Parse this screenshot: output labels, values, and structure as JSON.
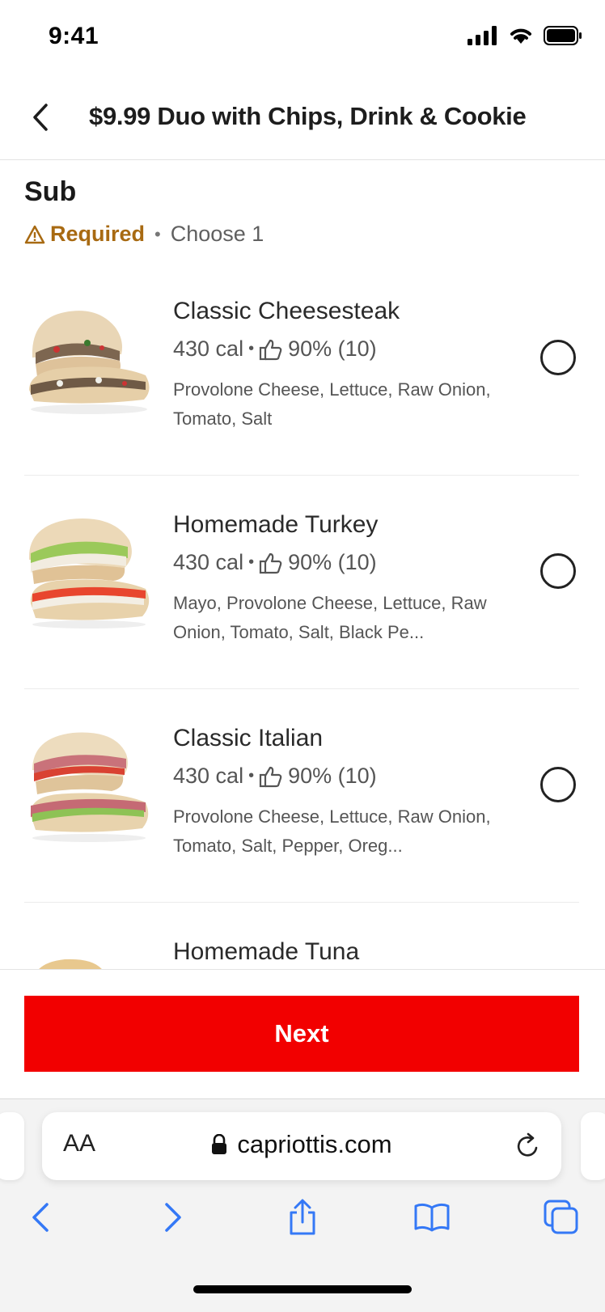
{
  "status_bar": {
    "time": "9:41"
  },
  "header": {
    "title": "$9.99 Duo with Chips, Drink & Cookie"
  },
  "section": {
    "title": "Sub",
    "required_label": "Required",
    "bullet": "•",
    "choose_label": "Choose 1"
  },
  "items": [
    {
      "name": "Classic Cheesesteak",
      "calories": "430 cal",
      "rating": "90% (10)",
      "description": "Provolone Cheese, Lettuce, Raw Onion, Tomato, Salt"
    },
    {
      "name": "Homemade Turkey",
      "calories": "430 cal",
      "rating": "90% (10)",
      "description": "Mayo, Provolone Cheese, Lettuce, Raw Onion, Tomato, Salt, Black Pe..."
    },
    {
      "name": "Classic Italian",
      "calories": "430 cal",
      "rating": "90% (10)",
      "description": "Provolone Cheese, Lettuce, Raw Onion, Tomato, Salt, Pepper, Oreg..."
    },
    {
      "name": "Homemade Tuna",
      "calories": "",
      "rating": "",
      "description": ""
    }
  ],
  "next_button": {
    "label": "Next"
  },
  "browser": {
    "text_size_label": "AA",
    "url": "capriottis.com"
  },
  "colors": {
    "accent_red": "#f20000",
    "required_amber": "#a86a12",
    "safari_blue": "#3478f6"
  }
}
